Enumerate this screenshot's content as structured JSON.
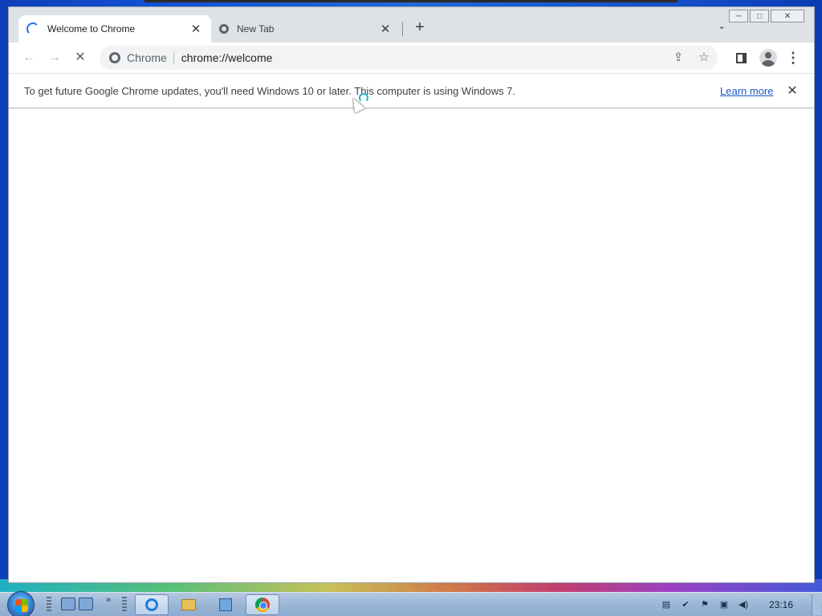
{
  "window": {
    "controls": {
      "minimize": "─",
      "maximize": "□",
      "close": "✕"
    }
  },
  "tabs": [
    {
      "title": "Welcome to Chrome",
      "state": "loading",
      "active": true,
      "close": "✕"
    },
    {
      "title": "New Tab",
      "state": "loaded",
      "active": false,
      "close": "✕"
    }
  ],
  "tabstrip": {
    "new_tab": "+",
    "tab_search": "⌄"
  },
  "toolbar": {
    "back": "←",
    "forward": "→",
    "stop": "✕",
    "chip_label": "Chrome",
    "url": "chrome://welcome",
    "share": "⇪",
    "bookmark": "☆",
    "menu": "⋮"
  },
  "infobar": {
    "message": "To get future Google Chrome updates, you'll need Windows 10 or later. This computer is using Windows 7.",
    "link": "Learn more",
    "close": "✕"
  },
  "taskbar": {
    "quicklaunch_more": "»",
    "apps": [
      {
        "name": "internet-explorer",
        "active": true
      },
      {
        "name": "windows-explorer",
        "active": false
      },
      {
        "name": "control-panel",
        "active": false
      },
      {
        "name": "google-chrome",
        "active": true
      }
    ],
    "tray_icons": [
      "notes-icon",
      "security-shield-icon",
      "flag-icon",
      "network-icon",
      "volume-icon"
    ],
    "clock": "23:16"
  },
  "colors": {
    "accent": "#1a73e8",
    "link": "#1a59c4",
    "tabstrip_bg": "#dee1e6",
    "taskbar": "#9bb6d6"
  }
}
